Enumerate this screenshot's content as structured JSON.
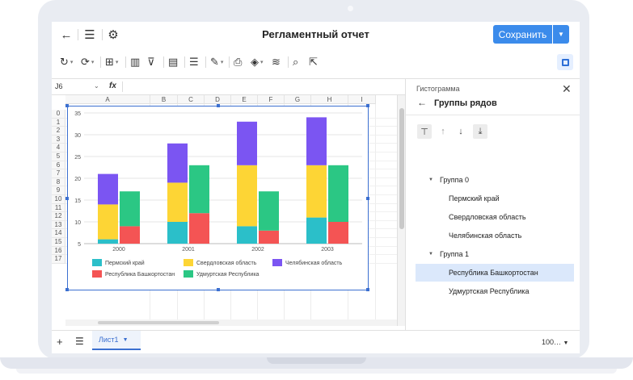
{
  "window": {
    "title": "Регламентный отчет",
    "save_label": "Сохранить"
  },
  "formula_bar": {
    "cell_ref": "J6",
    "fx_label": "fx"
  },
  "columns": [
    "A",
    "B",
    "C",
    "D",
    "E",
    "F",
    "G",
    "H",
    "I"
  ],
  "rows": [
    "0",
    "1",
    "2",
    "3",
    "4",
    "5",
    "6",
    "7",
    "8",
    "9",
    "10",
    "11",
    "12",
    "13",
    "14",
    "15",
    "16",
    "17"
  ],
  "side_panel": {
    "chart_type": "Гистограмма",
    "title": "Группы рядов",
    "tree": [
      {
        "label": "Группа 0",
        "kind": "group"
      },
      {
        "label": "Пермский край",
        "kind": "item"
      },
      {
        "label": "Свердловская область",
        "kind": "item"
      },
      {
        "label": "Челябинская область",
        "kind": "item"
      },
      {
        "label": "Группа 1",
        "kind": "group"
      },
      {
        "label": "Республика Башкортостан",
        "kind": "item",
        "selected": true
      },
      {
        "label": "Удмуртская Республика",
        "kind": "item"
      }
    ]
  },
  "bottom_bar": {
    "sheet_name": "Лист1",
    "zoom": "100…"
  },
  "chart_data": {
    "type": "bar",
    "stacked_groups": true,
    "categories": [
      "2000",
      "2001",
      "2002",
      "2003"
    ],
    "ylim": [
      5,
      35
    ],
    "yticks": [
      "5",
      "10",
      "15",
      "20",
      "25",
      "30",
      "35"
    ],
    "grid": true,
    "legend_position": "bottom",
    "groups": [
      {
        "series": [
          {
            "name": "Пермский край",
            "color": "#2bbfc9",
            "values": [
              6,
              10,
              9,
              11
            ]
          },
          {
            "name": "Свердловская область",
            "color": "#fdd535",
            "values": [
              8,
              9,
              14,
              12
            ]
          },
          {
            "name": "Челябинская область",
            "color": "#7b55f2",
            "values": [
              7,
              9,
              10,
              11
            ]
          }
        ]
      },
      {
        "series": [
          {
            "name": "Республика Башкортостан",
            "color": "#f45454",
            "values": [
              9,
              12,
              8,
              10
            ]
          },
          {
            "name": "Удмуртская Республика",
            "color": "#2bc784",
            "values": [
              8,
              11,
              9,
              13
            ]
          }
        ]
      }
    ]
  }
}
